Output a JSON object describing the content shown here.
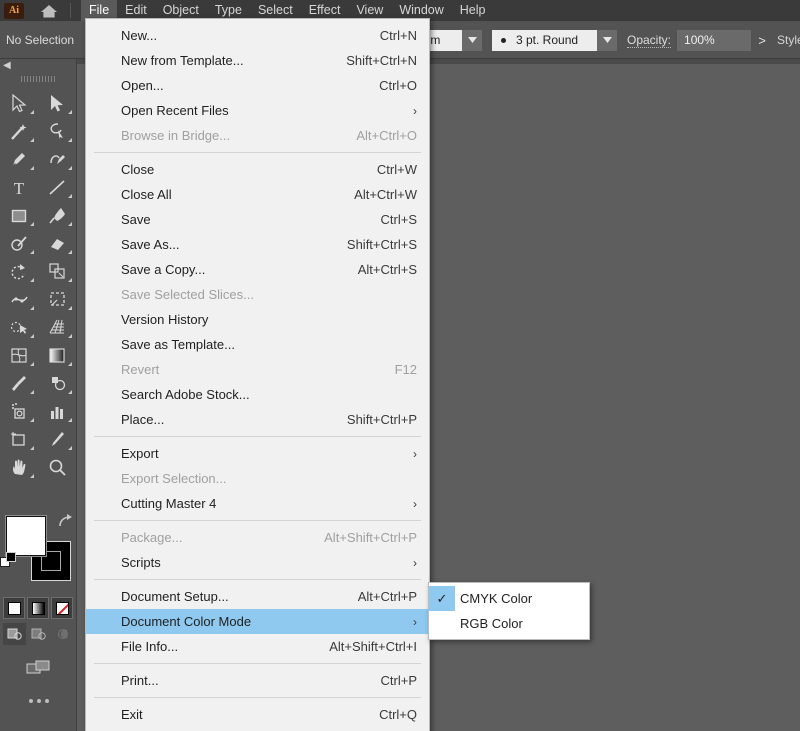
{
  "app": {
    "name": "Adobe Illustrator",
    "logo_text": "Ai",
    "home_icon": "home-icon"
  },
  "menubar": {
    "items": [
      {
        "label": "File",
        "active": true
      },
      {
        "label": "Edit",
        "active": false
      },
      {
        "label": "Object",
        "active": false
      },
      {
        "label": "Type",
        "active": false
      },
      {
        "label": "Select",
        "active": false
      },
      {
        "label": "Effect",
        "active": false
      },
      {
        "label": "View",
        "active": false
      },
      {
        "label": "Window",
        "active": false
      },
      {
        "label": "Help",
        "active": false
      }
    ]
  },
  "controlbar": {
    "selection_status": "No Selection",
    "profile_value": "niform",
    "brush_value": "3 pt. Round",
    "opacity_label": "Opacity:",
    "opacity_value": "100%",
    "style_label": "Style:",
    "chevron_right": ">",
    "chevron_down": "v"
  },
  "toolpanel": {
    "collapse_icon": "chevron-left-icon",
    "tools": [
      {
        "name": "selection-tool"
      },
      {
        "name": "direct-selection-tool"
      },
      {
        "name": "magic-wand-tool"
      },
      {
        "name": "lasso-tool"
      },
      {
        "name": "pen-tool"
      },
      {
        "name": "curvature-tool"
      },
      {
        "name": "type-tool"
      },
      {
        "name": "line-segment-tool"
      },
      {
        "name": "rectangle-tool"
      },
      {
        "name": "paintbrush-tool"
      },
      {
        "name": "shaper-tool"
      },
      {
        "name": "eraser-tool"
      },
      {
        "name": "rotate-tool"
      },
      {
        "name": "scale-tool"
      },
      {
        "name": "width-tool"
      },
      {
        "name": "free-transform-tool"
      },
      {
        "name": "shape-builder-tool"
      },
      {
        "name": "perspective-grid-tool"
      },
      {
        "name": "mesh-tool"
      },
      {
        "name": "gradient-tool"
      },
      {
        "name": "eyedropper-tool"
      },
      {
        "name": "blend-tool"
      },
      {
        "name": "symbol-sprayer-tool"
      },
      {
        "name": "column-graph-tool"
      },
      {
        "name": "artboard-tool"
      },
      {
        "name": "slice-tool"
      },
      {
        "name": "hand-tool"
      },
      {
        "name": "zoom-tool"
      }
    ],
    "fill_color": "#ffffff",
    "stroke_color": "#000000",
    "swap_icon": "swap-fill-stroke-icon",
    "color_modes": [
      {
        "name": "color-swatch-mode",
        "icon": "solid-color-icon"
      },
      {
        "name": "gradient-mode",
        "icon": "gradient-icon"
      },
      {
        "name": "none-mode",
        "icon": "none-icon"
      }
    ],
    "draw_modes": [
      {
        "name": "draw-normal-mode",
        "selected": true
      },
      {
        "name": "draw-behind-mode",
        "selected": false
      },
      {
        "name": "draw-inside-mode",
        "selected": false
      }
    ],
    "screen_mode": "change-screen-mode-icon",
    "more_tools": "edit-toolbar-icon"
  },
  "file_menu": {
    "groups": [
      {
        "items": [
          {
            "label": "New...",
            "accel": "Ctrl+N",
            "disabled": false,
            "submenu": false
          },
          {
            "label": "New from Template...",
            "accel": "Shift+Ctrl+N",
            "disabled": false,
            "submenu": false
          },
          {
            "label": "Open...",
            "accel": "Ctrl+O",
            "disabled": false,
            "submenu": false
          },
          {
            "label": "Open Recent Files",
            "accel": "",
            "disabled": false,
            "submenu": true
          },
          {
            "label": "Browse in Bridge...",
            "accel": "Alt+Ctrl+O",
            "disabled": true,
            "submenu": false
          }
        ]
      },
      {
        "items": [
          {
            "label": "Close",
            "accel": "Ctrl+W",
            "disabled": false,
            "submenu": false
          },
          {
            "label": "Close All",
            "accel": "Alt+Ctrl+W",
            "disabled": false,
            "submenu": false
          },
          {
            "label": "Save",
            "accel": "Ctrl+S",
            "disabled": false,
            "submenu": false
          },
          {
            "label": "Save As...",
            "accel": "Shift+Ctrl+S",
            "disabled": false,
            "submenu": false
          },
          {
            "label": "Save a Copy...",
            "accel": "Alt+Ctrl+S",
            "disabled": false,
            "submenu": false
          },
          {
            "label": "Save Selected Slices...",
            "accel": "",
            "disabled": true,
            "submenu": false
          },
          {
            "label": "Version History",
            "accel": "",
            "disabled": false,
            "submenu": false
          },
          {
            "label": "Save as Template...",
            "accel": "",
            "disabled": false,
            "submenu": false
          },
          {
            "label": "Revert",
            "accel": "F12",
            "disabled": true,
            "submenu": false
          },
          {
            "label": "Search Adobe Stock...",
            "accel": "",
            "disabled": false,
            "submenu": false
          },
          {
            "label": "Place...",
            "accel": "Shift+Ctrl+P",
            "disabled": false,
            "submenu": false
          }
        ]
      },
      {
        "items": [
          {
            "label": "Export",
            "accel": "",
            "disabled": false,
            "submenu": true
          },
          {
            "label": "Export Selection...",
            "accel": "",
            "disabled": true,
            "submenu": false
          },
          {
            "label": "Cutting Master 4",
            "accel": "",
            "disabled": false,
            "submenu": true
          }
        ]
      },
      {
        "items": [
          {
            "label": "Package...",
            "accel": "Alt+Shift+Ctrl+P",
            "disabled": true,
            "submenu": false
          },
          {
            "label": "Scripts",
            "accel": "",
            "disabled": false,
            "submenu": true
          }
        ]
      },
      {
        "items": [
          {
            "label": "Document Setup...",
            "accel": "Alt+Ctrl+P",
            "disabled": false,
            "submenu": false
          },
          {
            "label": "Document Color Mode",
            "accel": "",
            "disabled": false,
            "submenu": true,
            "highlighted": true
          },
          {
            "label": "File Info...",
            "accel": "Alt+Shift+Ctrl+I",
            "disabled": false,
            "submenu": false
          }
        ]
      },
      {
        "items": [
          {
            "label": "Print...",
            "accel": "Ctrl+P",
            "disabled": false,
            "submenu": false
          }
        ]
      },
      {
        "items": [
          {
            "label": "Exit",
            "accel": "Ctrl+Q",
            "disabled": false,
            "submenu": false
          }
        ]
      }
    ]
  },
  "color_mode_submenu": {
    "items": [
      {
        "label": "CMYK Color",
        "checked": true
      },
      {
        "label": "RGB Color",
        "checked": false
      }
    ],
    "check_glyph": "✓"
  },
  "colors": {
    "chrome_dark": "#3a3a3a",
    "panel_gray": "#535353",
    "canvas_gray": "#5e5e5e",
    "menu_bg": "#f1f1f1",
    "submenu_bg": "#ffffff",
    "highlight_blue": "#8fc9f0",
    "accent_orange": "#f2a24a"
  }
}
